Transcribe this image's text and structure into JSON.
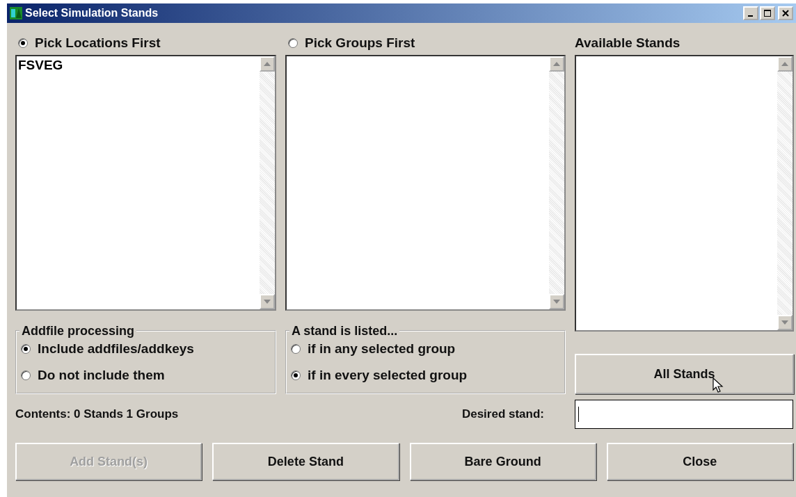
{
  "window": {
    "title": "Select Simulation Stands"
  },
  "modes": [
    {
      "label": "Pick Locations First",
      "selected": true
    },
    {
      "label": "Pick Groups First",
      "selected": false
    }
  ],
  "available_stands": {
    "label": "Available Stands"
  },
  "locations_list": {
    "items": [
      "FSVEG"
    ]
  },
  "addfile_processing": {
    "title": "Addfile processing",
    "options": [
      {
        "label": "Include addfiles/addkeys",
        "selected": true
      },
      {
        "label": "Do not include them",
        "selected": false
      }
    ]
  },
  "listing_rule": {
    "title": "A stand is listed...",
    "options": [
      {
        "label": "if in any selected group",
        "selected": false
      },
      {
        "label": "if in every selected group",
        "selected": true
      }
    ]
  },
  "all_stands_button": {
    "label": "All Stands"
  },
  "contents": "Contents: 0 Stands 1 Groups",
  "desired_stand": {
    "label": "Desired stand:"
  },
  "buttons": [
    {
      "label": "Add Stand(s)",
      "disabled": true
    },
    {
      "label": "Delete Stand",
      "disabled": false
    },
    {
      "label": "Bare Ground",
      "disabled": false
    },
    {
      "label": "Close",
      "disabled": false
    }
  ]
}
